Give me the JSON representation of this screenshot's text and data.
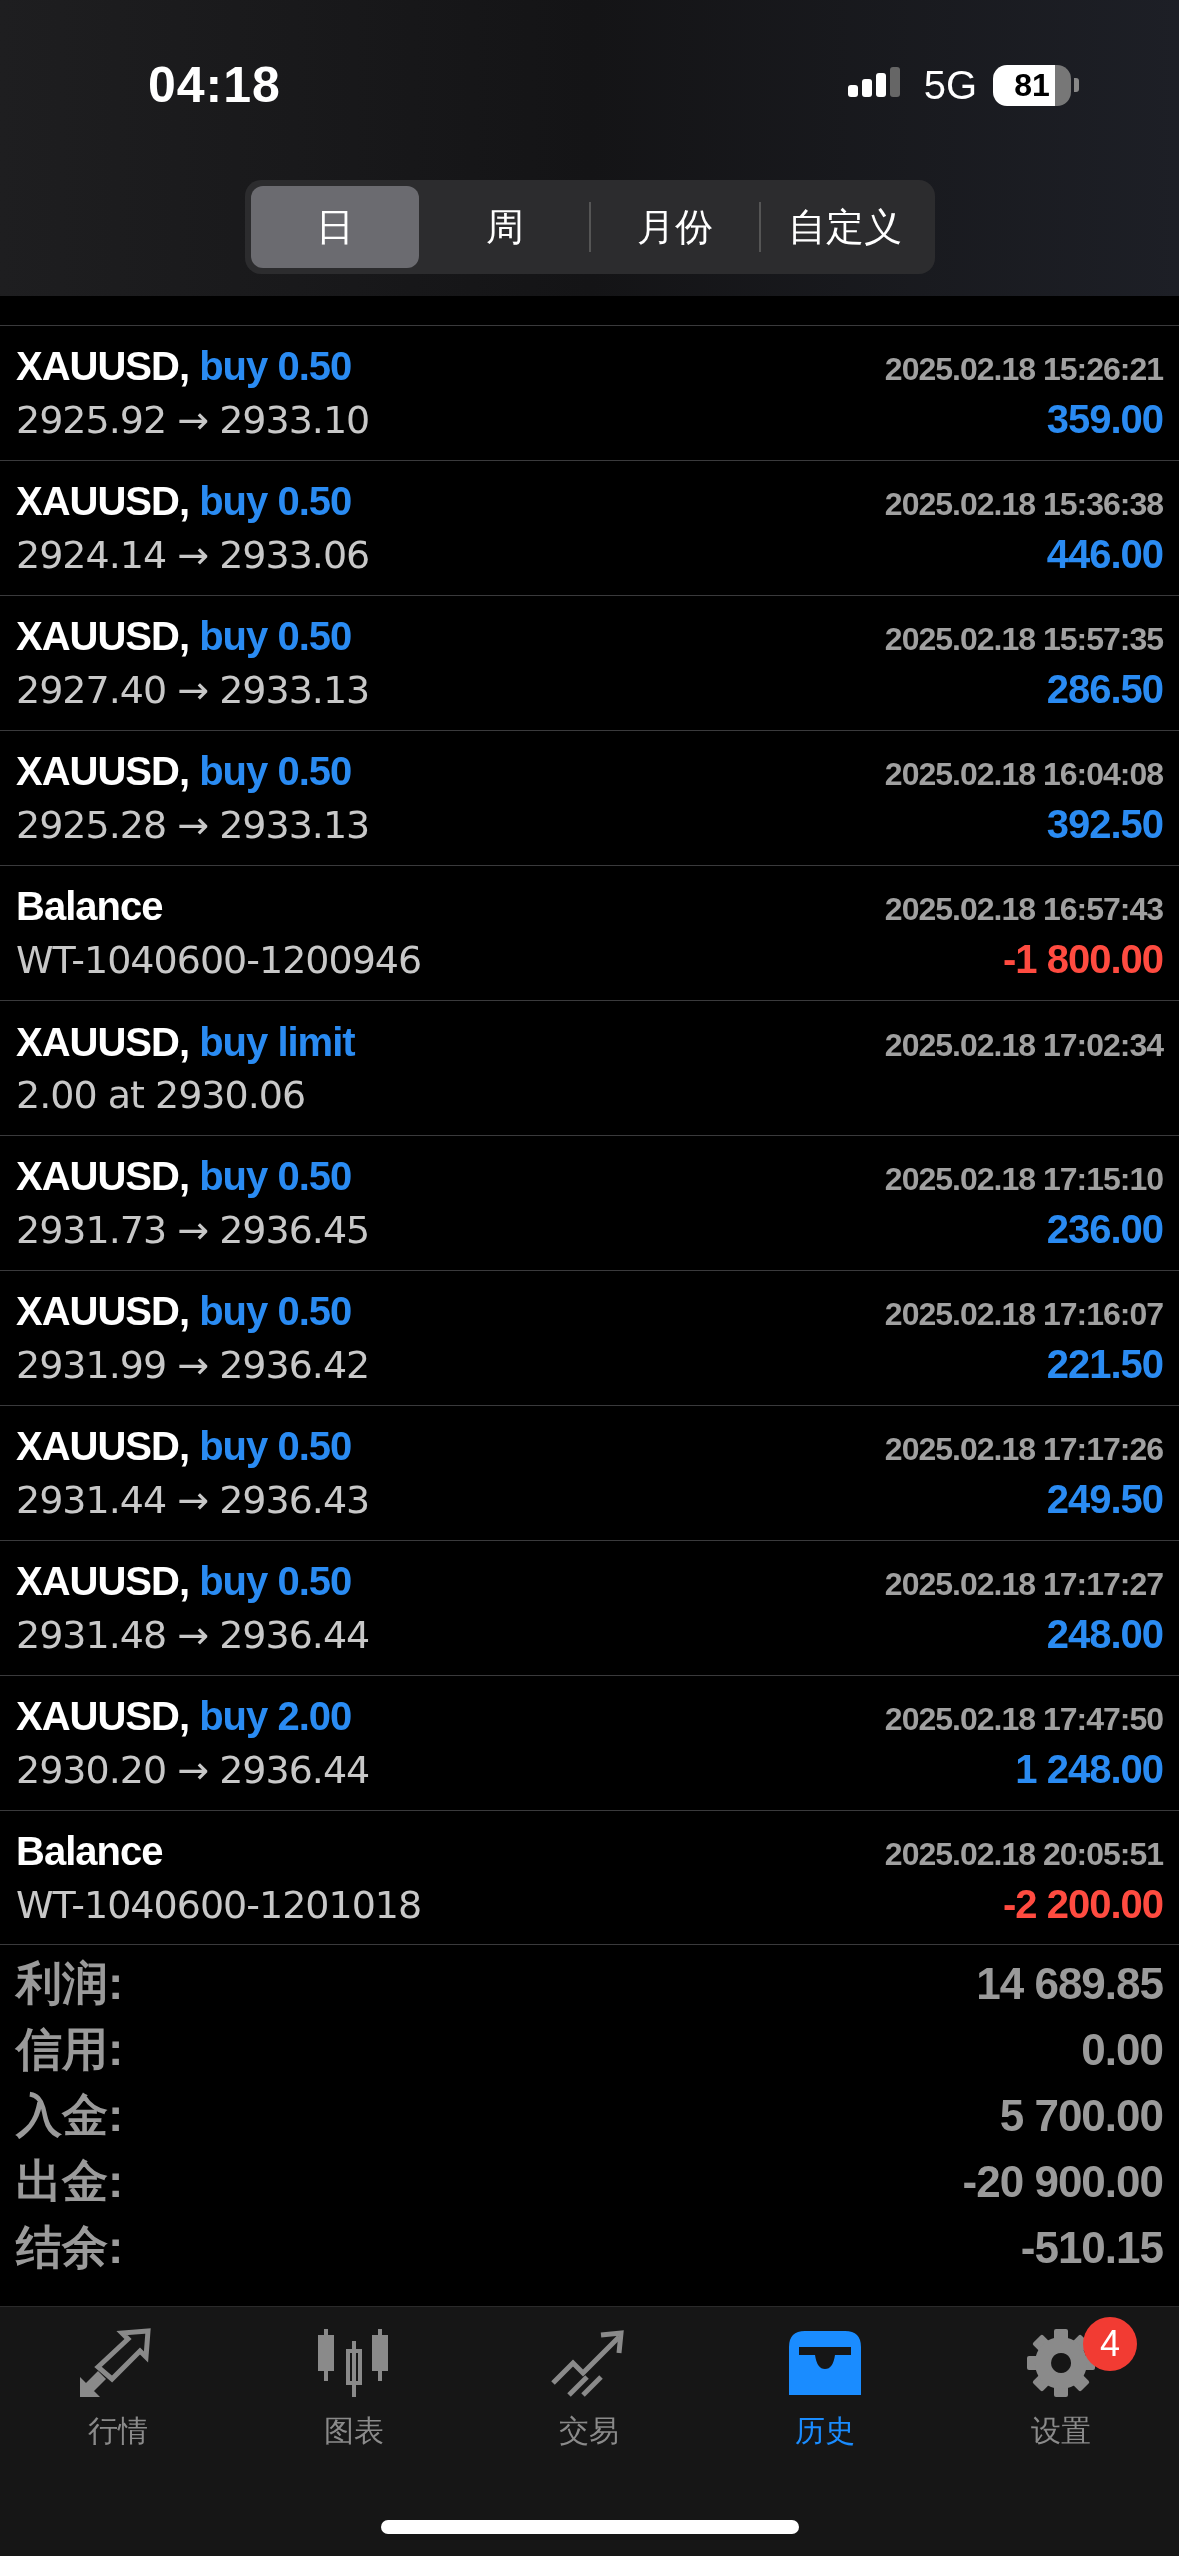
{
  "status_bar": {
    "time": "04:18",
    "network": "5G",
    "battery": "81"
  },
  "segments": [
    {
      "label": "日",
      "selected": true
    },
    {
      "label": "周",
      "selected": false
    },
    {
      "label": "月份",
      "selected": false
    },
    {
      "label": "自定义",
      "selected": false
    }
  ],
  "deals": [
    {
      "kind": "trade",
      "symbol": "XAUUSD,",
      "action": "buy 0.50",
      "time": "2025.02.18 15:26:21",
      "detail": "2925.92 → 2933.10",
      "amount": "359.00"
    },
    {
      "kind": "trade",
      "symbol": "XAUUSD,",
      "action": "buy 0.50",
      "time": "2025.02.18 15:36:38",
      "detail": "2924.14 → 2933.06",
      "amount": "446.00"
    },
    {
      "kind": "trade",
      "symbol": "XAUUSD,",
      "action": "buy 0.50",
      "time": "2025.02.18 15:57:35",
      "detail": "2927.40 → 2933.13",
      "amount": "286.50"
    },
    {
      "kind": "trade",
      "symbol": "XAUUSD,",
      "action": "buy 0.50",
      "time": "2025.02.18 16:04:08",
      "detail": "2925.28 → 2933.13",
      "amount": "392.50"
    },
    {
      "kind": "balance",
      "symbol": "Balance",
      "time": "2025.02.18 16:57:43",
      "detail": "WT-1040600-1200946",
      "amount": "-1 800.00"
    },
    {
      "kind": "order",
      "symbol": "XAUUSD,",
      "action": "buy limit",
      "time": "2025.02.18 17:02:34",
      "detail": "2.00 at 2930.06"
    },
    {
      "kind": "trade",
      "symbol": "XAUUSD,",
      "action": "buy 0.50",
      "time": "2025.02.18 17:15:10",
      "detail": "2931.73 → 2936.45",
      "amount": "236.00"
    },
    {
      "kind": "trade",
      "symbol": "XAUUSD,",
      "action": "buy 0.50",
      "time": "2025.02.18 17:16:07",
      "detail": "2931.99 → 2936.42",
      "amount": "221.50"
    },
    {
      "kind": "trade",
      "symbol": "XAUUSD,",
      "action": "buy 0.50",
      "time": "2025.02.18 17:17:26",
      "detail": "2931.44 → 2936.43",
      "amount": "249.50"
    },
    {
      "kind": "trade",
      "symbol": "XAUUSD,",
      "action": "buy 0.50",
      "time": "2025.02.18 17:17:27",
      "detail": "2931.48 → 2936.44",
      "amount": "248.00"
    },
    {
      "kind": "trade",
      "symbol": "XAUUSD,",
      "action": "buy 2.00",
      "time": "2025.02.18 17:47:50",
      "detail": "2930.20 → 2936.44",
      "amount": "1 248.00"
    },
    {
      "kind": "balance",
      "symbol": "Balance",
      "time": "2025.02.18 20:05:51",
      "detail": "WT-1040600-1201018",
      "amount": "-2 200.00"
    }
  ],
  "summary": [
    {
      "label": "利润:",
      "value": "14 689.85"
    },
    {
      "label": "信用:",
      "value": "0.00"
    },
    {
      "label": "入金:",
      "value": "5 700.00"
    },
    {
      "label": "出金:",
      "value": "-20 900.00"
    },
    {
      "label": "结余:",
      "value": "-510.15"
    }
  ],
  "tab_bar": [
    {
      "kind": "quotes",
      "label": "行情",
      "selected": false
    },
    {
      "kind": "chart",
      "label": "图表",
      "selected": false
    },
    {
      "kind": "trade",
      "label": "交易",
      "selected": false
    },
    {
      "kind": "history",
      "label": "历史",
      "selected": true
    },
    {
      "kind": "settings",
      "label": "设置",
      "selected": false,
      "badge": "4"
    }
  ]
}
